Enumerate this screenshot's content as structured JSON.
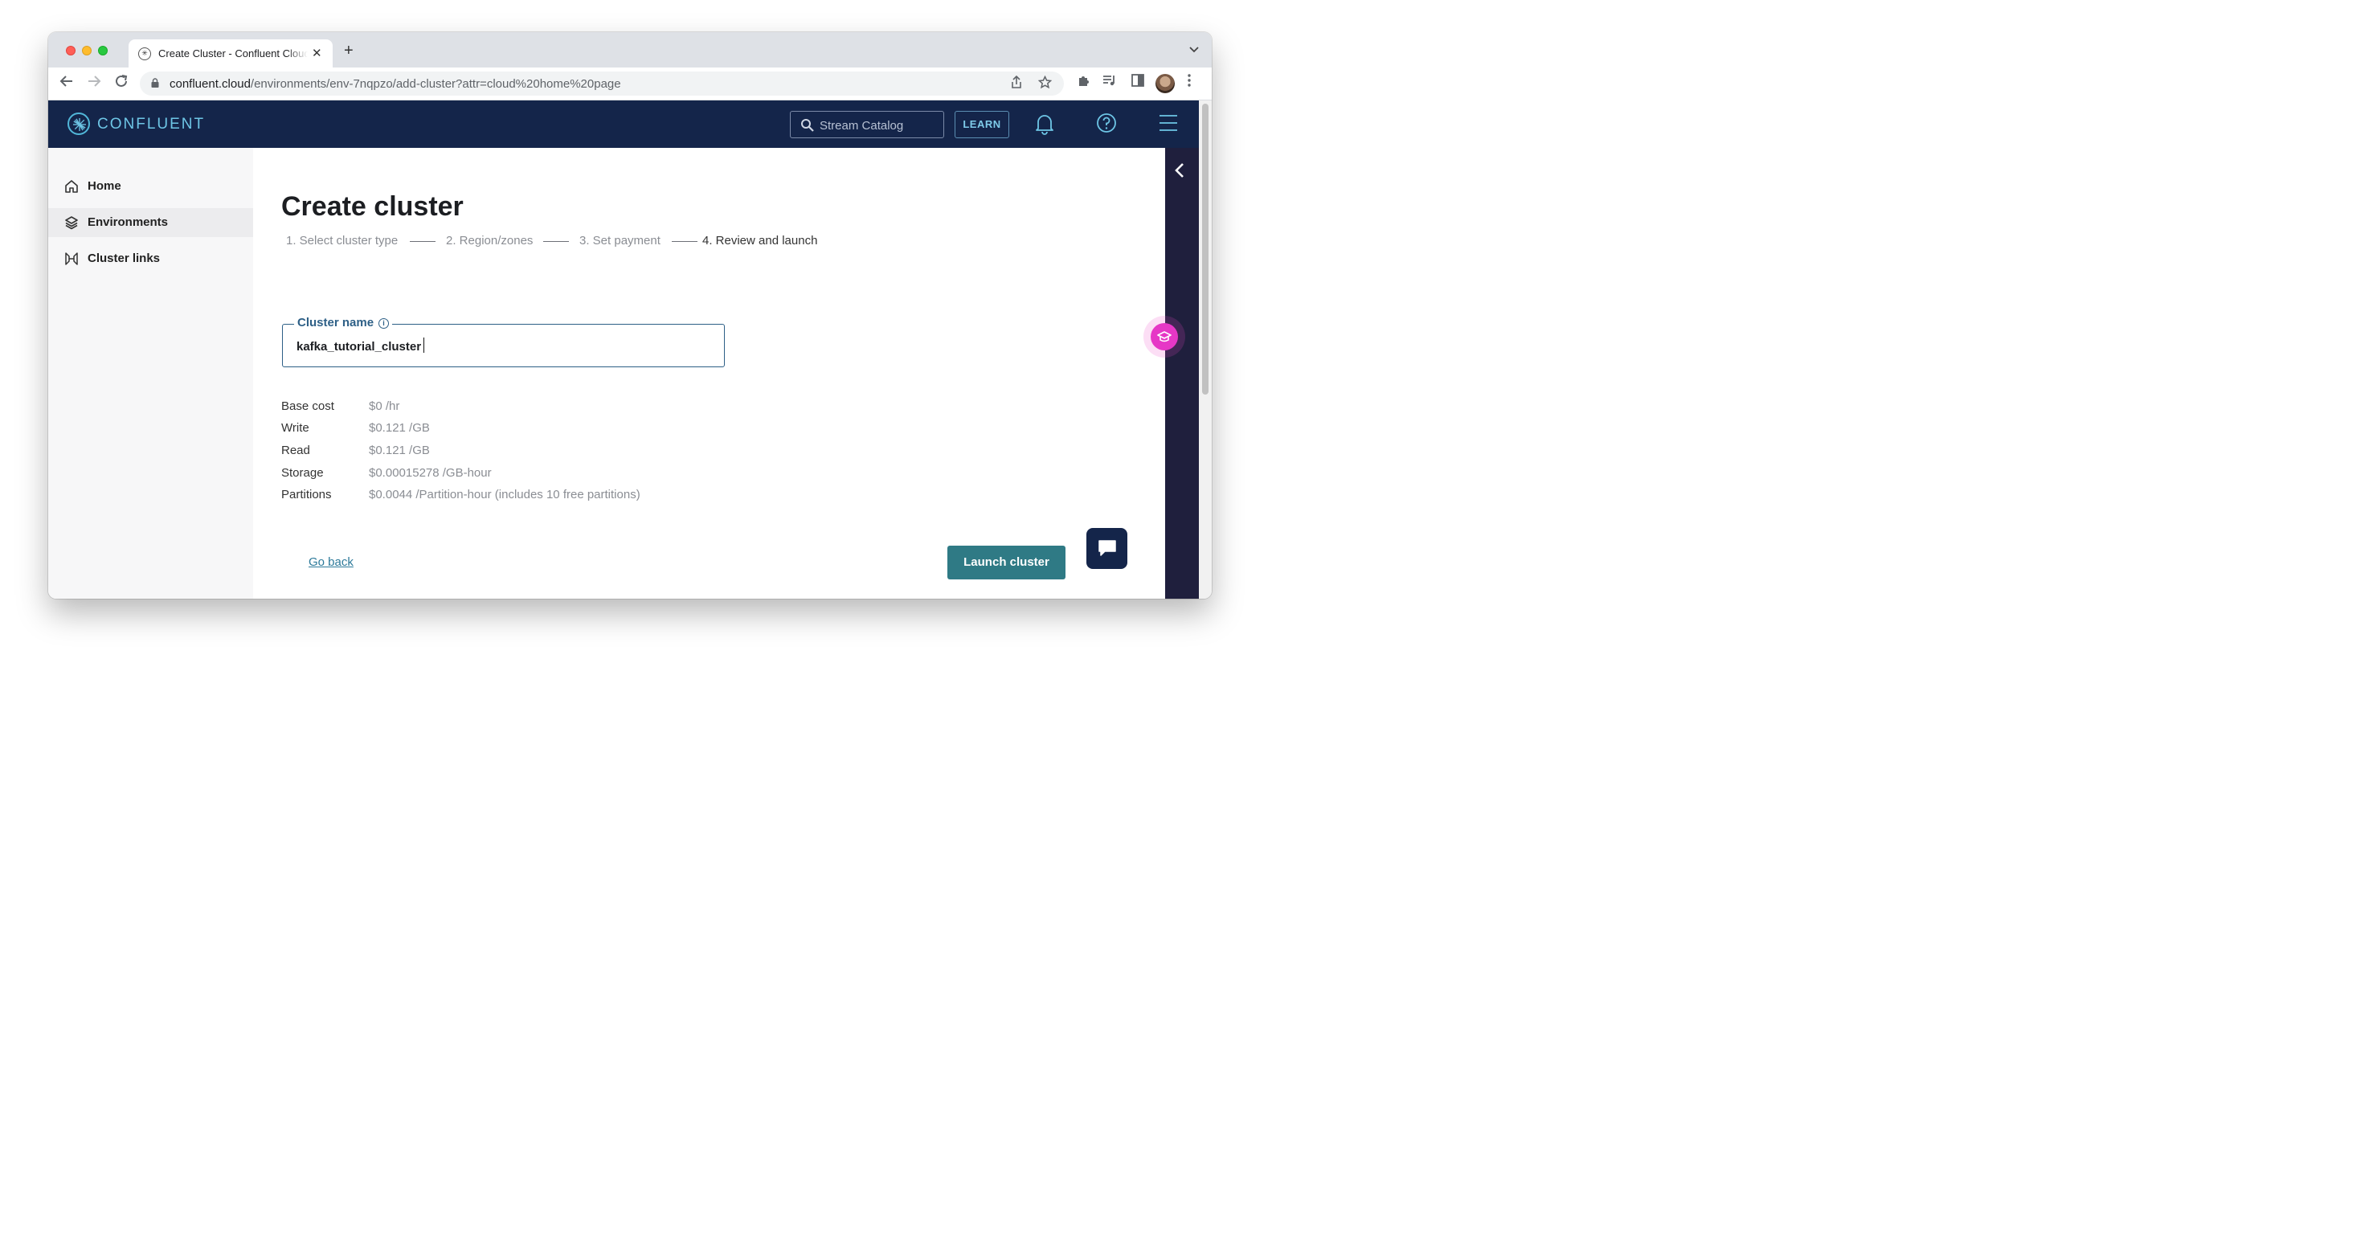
{
  "browser": {
    "tab_title": "Create Cluster - Confluent Cloud",
    "url_host": "confluent.cloud",
    "url_path": "/environments/env-7nqpzo/add-cluster?attr=cloud%20home%20page"
  },
  "header": {
    "logo_text": "CONFLUENT",
    "search_placeholder": "Stream Catalog",
    "learn_label": "LEARN",
    "brand_color": "#14254a",
    "accent_color": "#6ec6e6"
  },
  "sidebar": {
    "items": [
      {
        "label": "Home",
        "icon": "home-icon"
      },
      {
        "label": "Environments",
        "icon": "layers-icon",
        "active": true
      },
      {
        "label": "Cluster links",
        "icon": "link-icon"
      }
    ]
  },
  "main": {
    "title": "Create cluster",
    "steps": [
      {
        "label": "1. Select cluster type"
      },
      {
        "label": "2. Region/zones"
      },
      {
        "label": "3. Set payment"
      },
      {
        "label": "4. Review and launch",
        "current": true
      }
    ],
    "cluster_name": {
      "label": "Cluster name",
      "value": "kafka_tutorial_cluster"
    },
    "costs": [
      {
        "label": "Base cost",
        "value": "$0 /hr"
      },
      {
        "label": "Write",
        "value": "$0.121 /GB"
      },
      {
        "label": "Read",
        "value": "$0.121 /GB"
      },
      {
        "label": "Storage",
        "value": "$0.00015278 /GB-hour"
      },
      {
        "label": "Partitions",
        "value": "$0.0044 /Partition-hour (includes 10 free partitions)"
      }
    ],
    "go_back_label": "Go back",
    "launch_label": "Launch cluster",
    "launch_color": "#2f7a85"
  }
}
